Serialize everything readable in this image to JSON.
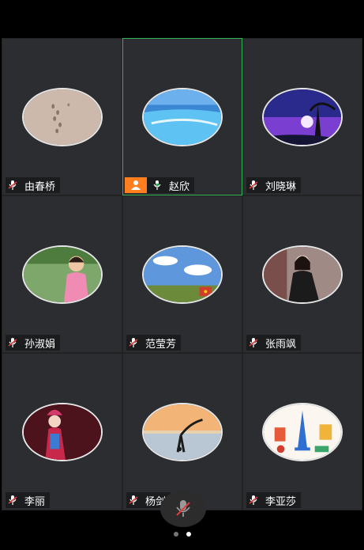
{
  "participants": [
    {
      "name": "由春桥",
      "avatar": "sand-footprints",
      "mic": "muted"
    },
    {
      "name": "赵欣",
      "avatar": "pool",
      "mic": "active",
      "host": true,
      "active_speaker": true
    },
    {
      "name": "刘晓琳",
      "avatar": "night-tree",
      "mic": "muted"
    },
    {
      "name": "孙淑娟",
      "avatar": "child",
      "mic": "muted"
    },
    {
      "name": "范莹芳",
      "avatar": "sky-field",
      "mic": "muted"
    },
    {
      "name": "张雨飒",
      "avatar": "woman-sitting",
      "mic": "muted"
    },
    {
      "name": "李丽",
      "avatar": "opera",
      "mic": "muted"
    },
    {
      "name": "杨剑",
      "avatar": "yoga",
      "mic": "muted"
    },
    {
      "name": "李亚莎",
      "avatar": "paris-illustration",
      "mic": "muted"
    }
  ],
  "controls": {
    "self_mic": "muted-mic-icon"
  },
  "pager": {
    "total": 2,
    "current": 2
  },
  "colors": {
    "active_border": "#2fb456",
    "host_badge": "#ff7f1f",
    "muted_red": "#e23b3b"
  }
}
